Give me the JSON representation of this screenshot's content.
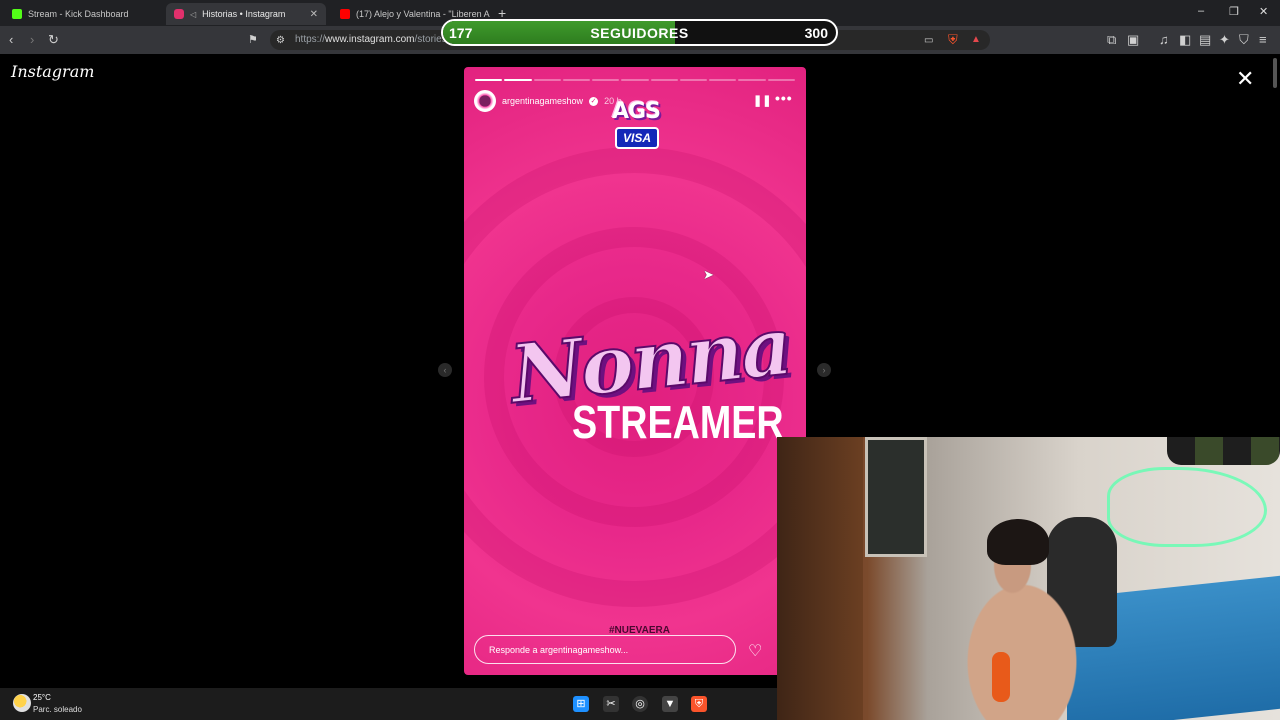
{
  "tabs": [
    {
      "title": "Stream - Kick Dashboard",
      "color": "#53fc18"
    },
    {
      "title": "Historias • Instagram",
      "color": "#e1306c"
    },
    {
      "title": "(17) Alejo y Valentina - \"Liberen A Ca",
      "color": "#ff0000"
    }
  ],
  "address": {
    "scheme": "https://",
    "host": "www.instagram.com",
    "path": "/stories/"
  },
  "followers": {
    "current": "177",
    "label": "SEGUIDORES",
    "goal": "300",
    "progress": 0.59
  },
  "instagram": {
    "logo": "Instagram"
  },
  "story": {
    "username": "argentinagameshow",
    "time": "20 h",
    "brand_top": "AGS",
    "brand_badge": "VISA",
    "headline": "Nonna",
    "subheadline": "STREAMER",
    "hashtag": "#NUEVAERA",
    "reply_placeholder": "Responde a argentinagameshow...",
    "segments_total": 11,
    "segments_done": 2
  },
  "taskbar": {
    "temperature": "25°C",
    "weather": "Parc. soleado"
  }
}
